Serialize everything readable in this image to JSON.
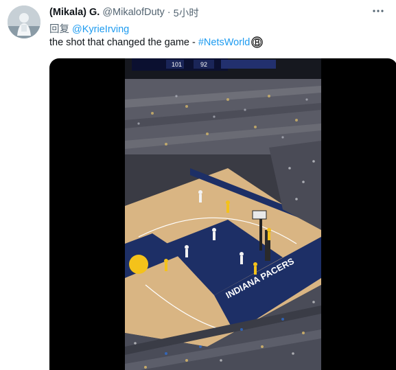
{
  "tweet": {
    "display_name": "(Mikala) G.",
    "handle": "@MikalofDuty",
    "separator": "·",
    "time": "5小时",
    "more_icon": "more-dots-icon",
    "reply_prefix": "回复",
    "reply_to": "@KyrieIrving",
    "text": "the shot that changed the game - ",
    "hashtag": "#NetsWorld",
    "emoji": "nets-logo-icon"
  },
  "video": {
    "scoreboard": {
      "home_score": "101",
      "away_score": "92"
    },
    "sideline_text": "INDIANA PACERS",
    "colors": {
      "court": "#d9b583",
      "paint": "#1d2f66",
      "accent": "#f4c21a"
    }
  }
}
